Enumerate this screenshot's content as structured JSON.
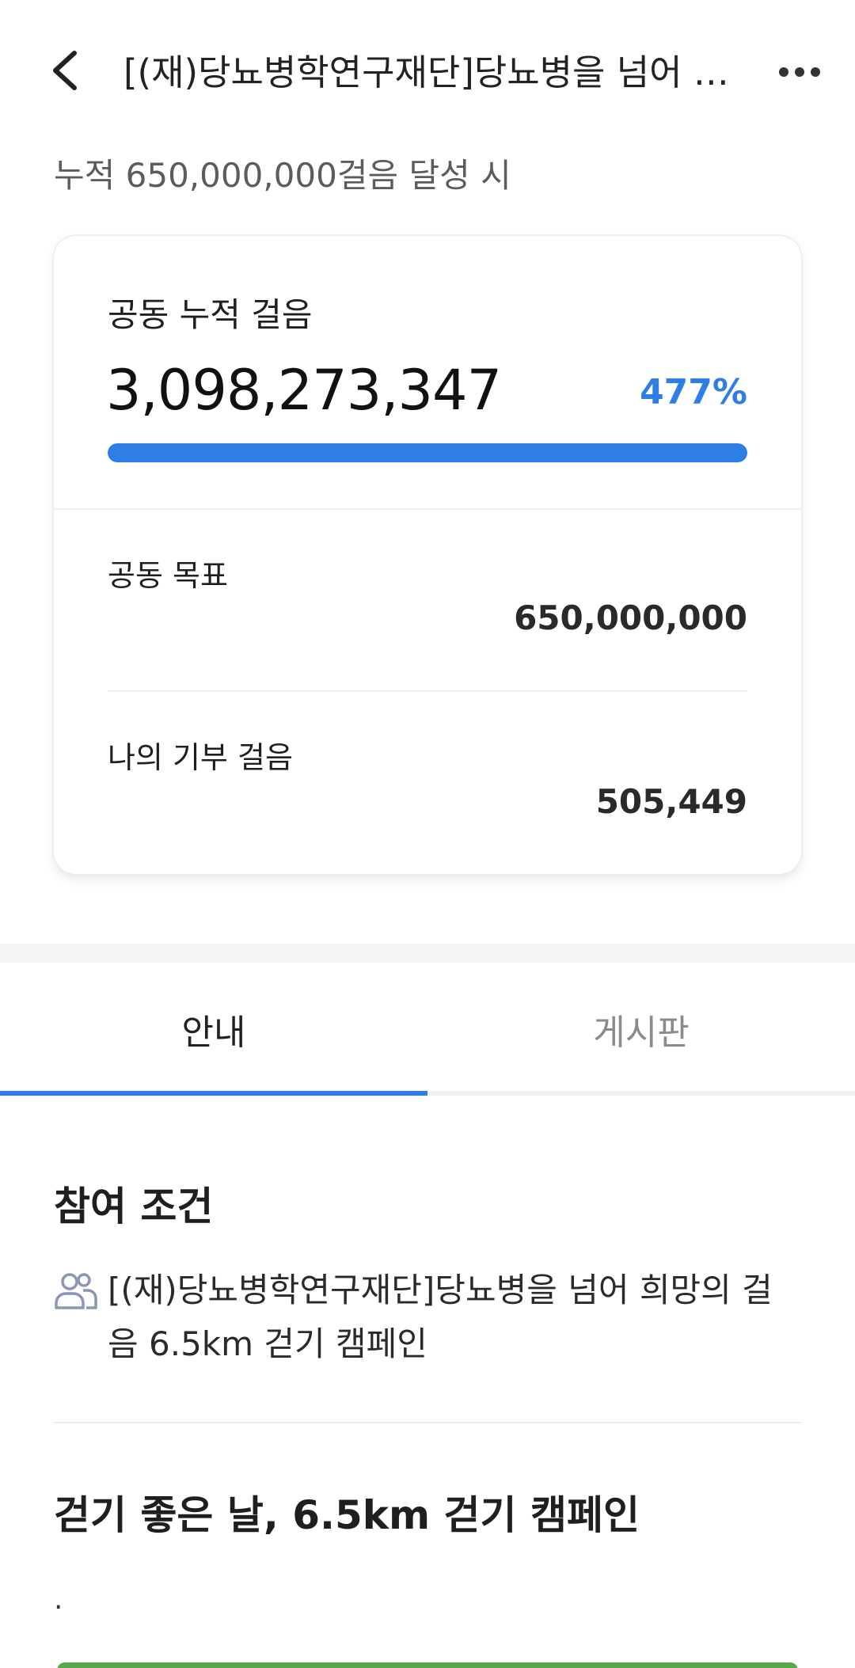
{
  "header": {
    "title": "[(재)당뇨병학연구재단]당뇨병을 넘어 …",
    "back_icon": "chevron-left-icon",
    "more_icon": "more-horizontal-icon"
  },
  "goal_caption": "누적 650,000,000걸음 달성 시",
  "card": {
    "total_label": "공동 누적 걸음",
    "total_value": "3,098,273,347",
    "total_percent": "477%",
    "progress_fraction": 1.0,
    "goal_label": "공동 목표",
    "goal_value": "650,000,000",
    "my_label": "나의 기부 걸음",
    "my_value": "505,449"
  },
  "tabs": [
    {
      "label": "안내",
      "active": true
    },
    {
      "label": "게시판",
      "active": false
    }
  ],
  "conditions": {
    "heading": "참여 조건",
    "icon": "people-icon",
    "text": "[(재)당뇨병학연구재단]당뇨병을 넘어 희망의 걸음 6.5km 걷기 캠페인"
  },
  "campaign": {
    "heading": "걷기 좋은 날, 6.5km 걷기 캠페인",
    "body": "."
  },
  "colors": {
    "accent": "#2f7ee6",
    "bottom_green": "#5aa64e"
  }
}
